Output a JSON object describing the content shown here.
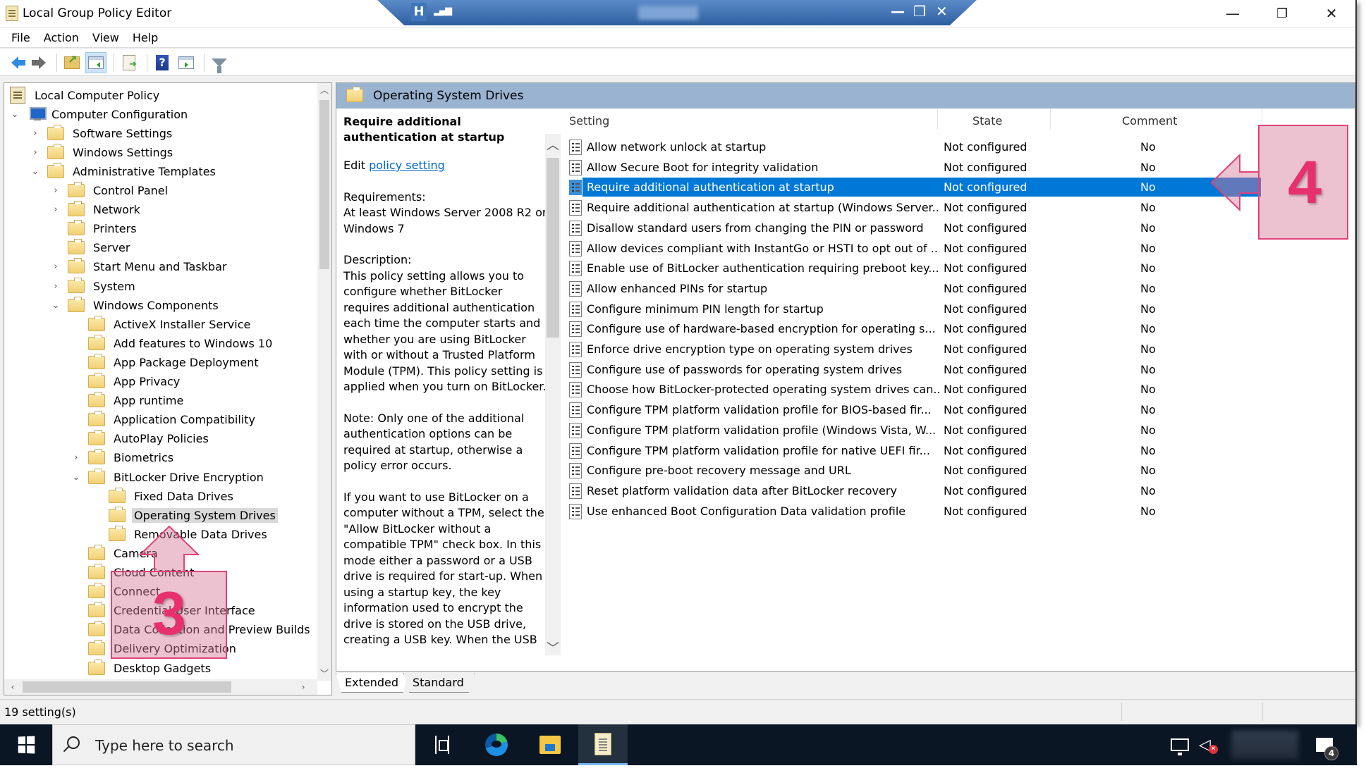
{
  "window": {
    "title": "Local Group Policy Editor",
    "controls": {
      "minimize": "—",
      "restore": "❐",
      "close": "✕"
    }
  },
  "remote_bar": {
    "pin_icon": "H",
    "signal_icon": "▂▄▆",
    "minimize": "—",
    "restore": "❐",
    "close": "✕"
  },
  "menu": [
    "File",
    "Action",
    "View",
    "Help"
  ],
  "toolbar": {
    "buttons": [
      "back-icon",
      "forward-icon",
      "up-one-level-icon",
      "show-hide-console-tree-icon",
      "export-list-icon",
      "help-icon",
      "show-hide-action-pane-icon",
      "filter-icon"
    ]
  },
  "tree": {
    "items": [
      {
        "label": "Local Computer Policy",
        "level": 0,
        "expander": "",
        "icon": "policy"
      },
      {
        "label": "Computer Configuration",
        "level": 0,
        "expander": "expanded",
        "icon": "computer"
      },
      {
        "label": "Software Settings",
        "level": 1,
        "expander": "collapsed",
        "icon": "folder"
      },
      {
        "label": "Windows Settings",
        "level": 1,
        "expander": "collapsed",
        "icon": "folder"
      },
      {
        "label": "Administrative Templates",
        "level": 1,
        "expander": "expanded",
        "icon": "folder"
      },
      {
        "label": "Control Panel",
        "level": 2,
        "expander": "collapsed",
        "icon": "folder"
      },
      {
        "label": "Network",
        "level": 2,
        "expander": "collapsed",
        "icon": "folder"
      },
      {
        "label": "Printers",
        "level": 2,
        "expander": "",
        "icon": "folder"
      },
      {
        "label": "Server",
        "level": 2,
        "expander": "",
        "icon": "folder"
      },
      {
        "label": "Start Menu and Taskbar",
        "level": 2,
        "expander": "collapsed",
        "icon": "folder"
      },
      {
        "label": "System",
        "level": 2,
        "expander": "collapsed",
        "icon": "folder"
      },
      {
        "label": "Windows Components",
        "level": 2,
        "expander": "expanded",
        "icon": "folder"
      },
      {
        "label": "ActiveX Installer Service",
        "level": 3,
        "expander": "",
        "icon": "folder"
      },
      {
        "label": "Add features to Windows 10",
        "level": 3,
        "expander": "",
        "icon": "folder"
      },
      {
        "label": "App Package Deployment",
        "level": 3,
        "expander": "",
        "icon": "folder"
      },
      {
        "label": "App Privacy",
        "level": 3,
        "expander": "",
        "icon": "folder"
      },
      {
        "label": "App runtime",
        "level": 3,
        "expander": "",
        "icon": "folder"
      },
      {
        "label": "Application Compatibility",
        "level": 3,
        "expander": "",
        "icon": "folder"
      },
      {
        "label": "AutoPlay Policies",
        "level": 3,
        "expander": "",
        "icon": "folder"
      },
      {
        "label": "Biometrics",
        "level": 3,
        "expander": "collapsed",
        "icon": "folder"
      },
      {
        "label": "BitLocker Drive Encryption",
        "level": 3,
        "expander": "expanded",
        "icon": "folder"
      },
      {
        "label": "Fixed Data Drives",
        "level": 4,
        "expander": "",
        "icon": "folder"
      },
      {
        "label": "Operating System Drives",
        "level": 4,
        "expander": "",
        "icon": "folder",
        "selected": true
      },
      {
        "label": "Removable Data Drives",
        "level": 4,
        "expander": "",
        "icon": "folder"
      },
      {
        "label": "Camera",
        "level": 3,
        "expander": "",
        "icon": "folder"
      },
      {
        "label": "Cloud Content",
        "level": 3,
        "expander": "",
        "icon": "folder"
      },
      {
        "label": "Connect",
        "level": 3,
        "expander": "",
        "icon": "folder"
      },
      {
        "label": "Credential User Interface",
        "level": 3,
        "expander": "",
        "icon": "folder"
      },
      {
        "label": "Data Collection and Preview Builds",
        "level": 3,
        "expander": "",
        "icon": "folder"
      },
      {
        "label": "Delivery Optimization",
        "level": 3,
        "expander": "",
        "icon": "folder"
      },
      {
        "label": "Desktop Gadgets",
        "level": 3,
        "expander": "",
        "icon": "folder"
      }
    ]
  },
  "right_pane": {
    "header": "Operating System Drives",
    "description": {
      "title": "Require additional authentication at startup",
      "edit_prefix": "Edit",
      "edit_link": "policy setting",
      "requirements_label": "Requirements:",
      "requirements": "At least Windows Server 2008 R2 or Windows 7",
      "description_label": "Description:",
      "paragraphs": [
        "This policy setting allows you to configure whether BitLocker requires additional authentication each time the computer starts and whether you are using BitLocker with or without a Trusted Platform Module (TPM). This policy setting is applied when you turn on BitLocker.",
        "Note: Only one of the additional authentication options can be required at startup, otherwise a policy error occurs.",
        "If you want to use BitLocker on a computer without a TPM, select the \"Allow BitLocker without a compatible TPM\" check box. In this mode either a password or a USB drive is required for start-up. When using a startup key, the key information used to encrypt the drive is stored on the USB drive, creating a USB key. When the USB"
      ]
    },
    "columns": [
      "Setting",
      "State",
      "Comment"
    ],
    "rows": [
      {
        "setting": "Allow network unlock at startup",
        "state": "Not configured",
        "comment": "No"
      },
      {
        "setting": "Allow Secure Boot for integrity validation",
        "state": "Not configured",
        "comment": "No"
      },
      {
        "setting": "Require additional authentication at startup",
        "state": "Not configured",
        "comment": "No",
        "selected": true
      },
      {
        "setting": "Require additional authentication at startup (Windows Server...",
        "state": "Not configured",
        "comment": "No"
      },
      {
        "setting": "Disallow standard users from changing the PIN or password",
        "state": "Not configured",
        "comment": "No"
      },
      {
        "setting": "Allow devices compliant with InstantGo or HSTI to opt out of ...",
        "state": "Not configured",
        "comment": "No"
      },
      {
        "setting": "Enable use of BitLocker authentication requiring preboot key...",
        "state": "Not configured",
        "comment": "No"
      },
      {
        "setting": "Allow enhanced PINs for startup",
        "state": "Not configured",
        "comment": "No"
      },
      {
        "setting": "Configure minimum PIN length for startup",
        "state": "Not configured",
        "comment": "No"
      },
      {
        "setting": "Configure use of hardware-based encryption for operating s...",
        "state": "Not configured",
        "comment": "No"
      },
      {
        "setting": "Enforce drive encryption type on operating system drives",
        "state": "Not configured",
        "comment": "No"
      },
      {
        "setting": "Configure use of passwords for operating system drives",
        "state": "Not configured",
        "comment": "No"
      },
      {
        "setting": "Choose how BitLocker-protected operating system drives can...",
        "state": "Not configured",
        "comment": "No"
      },
      {
        "setting": "Configure TPM platform validation profile for BIOS-based fir...",
        "state": "Not configured",
        "comment": "No"
      },
      {
        "setting": "Configure TPM platform validation profile (Windows Vista, W...",
        "state": "Not configured",
        "comment": "No"
      },
      {
        "setting": "Configure TPM platform validation profile for native UEFI fir...",
        "state": "Not configured",
        "comment": "No"
      },
      {
        "setting": "Configure pre-boot recovery message and URL",
        "state": "Not configured",
        "comment": "No"
      },
      {
        "setting": "Reset platform validation data after BitLocker recovery",
        "state": "Not configured",
        "comment": "No"
      },
      {
        "setting": "Use enhanced Boot Configuration Data validation profile",
        "state": "Not configured",
        "comment": "No"
      }
    ],
    "tabs": [
      {
        "label": "Extended",
        "active": true
      },
      {
        "label": "Standard",
        "active": false
      }
    ]
  },
  "status_bar": {
    "text": "19 setting(s)"
  },
  "taskbar": {
    "search_placeholder": "Type here to search",
    "notification_count": "4",
    "pinned": [
      "task-view",
      "edge",
      "file-explorer",
      "group-policy-editor"
    ]
  },
  "annotations": [
    {
      "number": "3",
      "target": "Operating System Drives (tree)"
    },
    {
      "number": "4",
      "target": "Require additional authentication at startup (list)"
    }
  ],
  "colors": {
    "selection": "#0078d7",
    "header_band": "#9ab3d1",
    "annotation": "#e0427a",
    "taskbar": "#0b1624",
    "link": "#0066cc"
  }
}
